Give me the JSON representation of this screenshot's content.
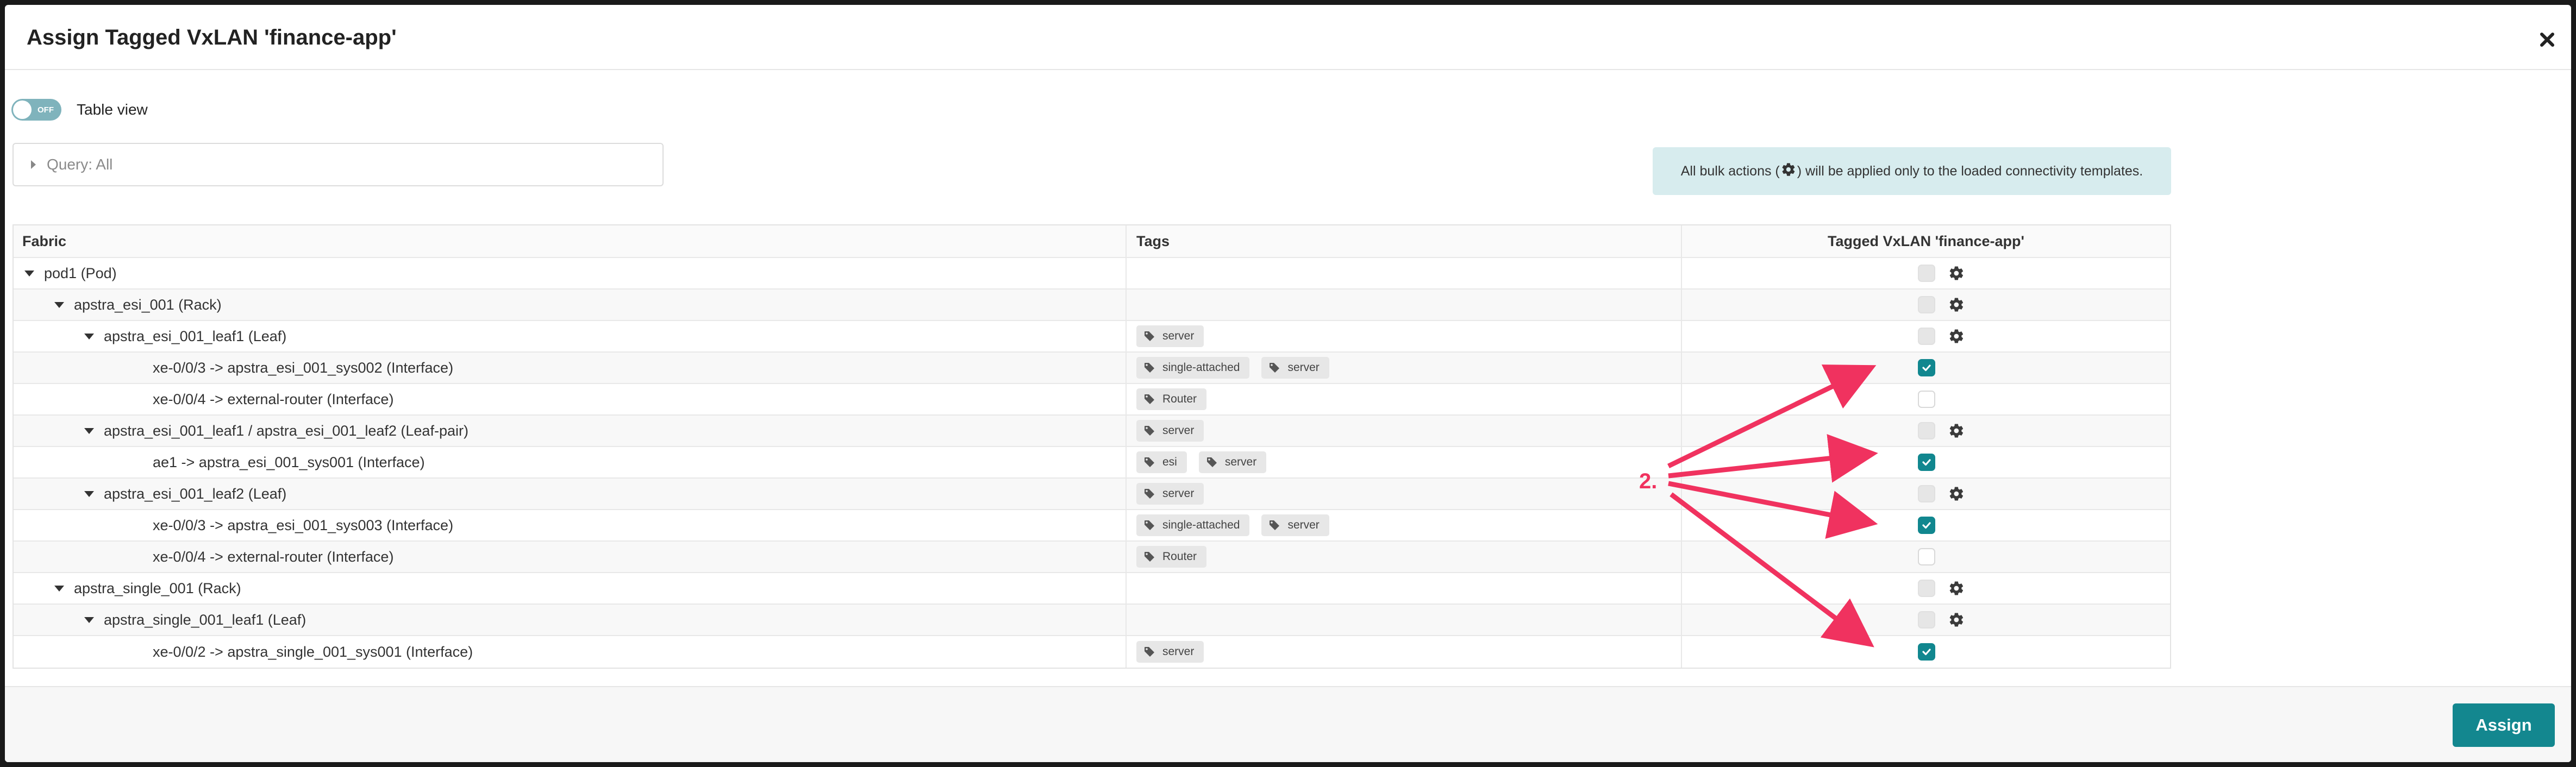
{
  "dialog": {
    "title": "Assign Tagged VxLAN 'finance-app'",
    "close_icon": "close-icon"
  },
  "table_view": {
    "label": "Table view",
    "toggle_state": "OFF",
    "enabled": false
  },
  "query": {
    "label": "Query: All"
  },
  "info": {
    "text_before": "All bulk actions (",
    "icon": "gear-icon",
    "text_after": ") will be applied only to the loaded connectivity templates."
  },
  "table": {
    "columns": [
      "Fabric",
      "Tags",
      "Tagged VxLAN 'finance-app'"
    ],
    "rows": [
      {
        "label": "pod1 (Pod)",
        "level": 1,
        "expander": true,
        "tags": [],
        "checked": false,
        "gear": true
      },
      {
        "label": "apstra_esi_001 (Rack)",
        "level": 2,
        "expander": true,
        "tags": [],
        "checked": false,
        "gear": true
      },
      {
        "label": "apstra_esi_001_leaf1 (Leaf)",
        "level": 3,
        "expander": true,
        "tags": [
          "server"
        ],
        "checked": false,
        "gear": true
      },
      {
        "label": "xe-0/0/3 -> apstra_esi_001_sys002 (Interface)",
        "level": 4,
        "expander": false,
        "tags": [
          "single-attached",
          "server"
        ],
        "checked": true,
        "gear": false
      },
      {
        "label": "xe-0/0/4 -> external-router (Interface)",
        "level": 4,
        "expander": false,
        "tags": [
          "Router"
        ],
        "checked": false,
        "gear": false
      },
      {
        "label": "apstra_esi_001_leaf1 / apstra_esi_001_leaf2 (Leaf-pair)",
        "level": 3,
        "expander": true,
        "tags": [
          "server"
        ],
        "checked": false,
        "gear": true
      },
      {
        "label": "ae1 -> apstra_esi_001_sys001 (Interface)",
        "level": 4,
        "expander": false,
        "tags": [
          "esi",
          "server"
        ],
        "checked": true,
        "gear": false
      },
      {
        "label": "apstra_esi_001_leaf2 (Leaf)",
        "level": 3,
        "expander": true,
        "tags": [
          "server"
        ],
        "checked": false,
        "gear": true
      },
      {
        "label": "xe-0/0/3 -> apstra_esi_001_sys003 (Interface)",
        "level": 4,
        "expander": false,
        "tags": [
          "single-attached",
          "server"
        ],
        "checked": true,
        "gear": false
      },
      {
        "label": "xe-0/0/4 -> external-router (Interface)",
        "level": 4,
        "expander": false,
        "tags": [
          "Router"
        ],
        "checked": false,
        "gear": false
      },
      {
        "label": "apstra_single_001 (Rack)",
        "level": 2,
        "expander": true,
        "tags": [],
        "checked": false,
        "gear": true
      },
      {
        "label": "apstra_single_001_leaf1 (Leaf)",
        "level": 3,
        "expander": true,
        "tags": [],
        "checked": false,
        "gear": true
      },
      {
        "label": "xe-0/0/2 -> apstra_single_001_sys001 (Interface)",
        "level": 4,
        "expander": false,
        "tags": [
          "server"
        ],
        "checked": true,
        "gear": false
      }
    ]
  },
  "footer": {
    "assign_label": "Assign"
  },
  "annotation": {
    "label": "2.",
    "color": "#f0325f"
  },
  "colors": {
    "accent": "#13878f",
    "info_bg": "#d7ecee",
    "annotation": "#f0325f"
  }
}
